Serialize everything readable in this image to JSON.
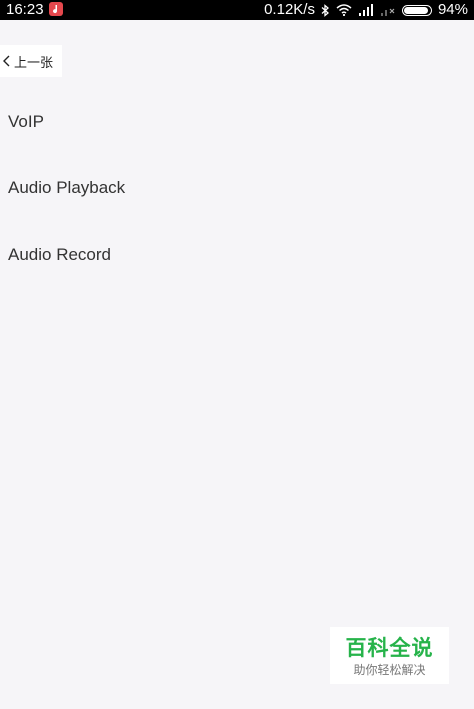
{
  "status_bar": {
    "time": "16:23",
    "network_speed": "0.12K/s",
    "battery_percent": "94%",
    "battery_level": 0.94,
    "icons": [
      "notification-app-icon",
      "bluetooth-icon",
      "wifi-icon",
      "signal-icon",
      "no-signal-icon",
      "battery-icon"
    ]
  },
  "nav": {
    "back_label": "上一张"
  },
  "menu": {
    "items": [
      {
        "label": "VoIP"
      },
      {
        "label": "Audio Playback"
      },
      {
        "label": "Audio Record"
      }
    ]
  },
  "watermark": {
    "title": "百科全说",
    "subtitle": "助你轻松解决",
    "color": "#26b34a"
  }
}
